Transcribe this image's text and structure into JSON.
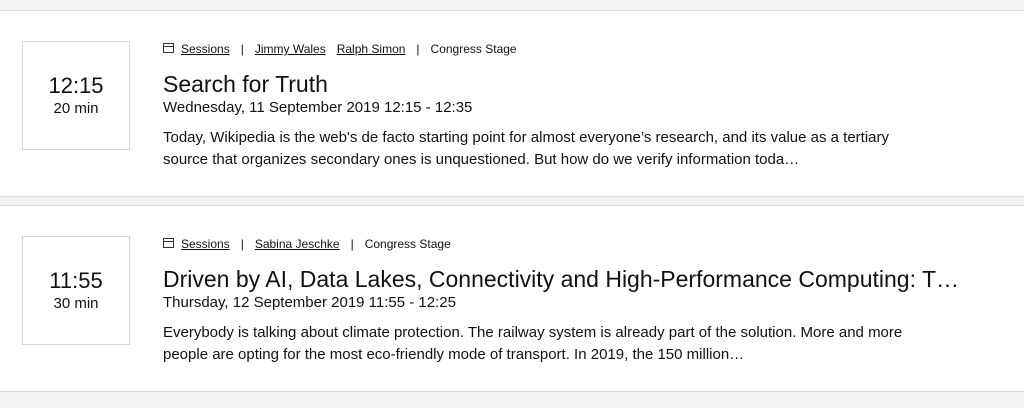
{
  "sessions": [
    {
      "time": "12:15",
      "duration": "20 min",
      "category": "Sessions",
      "speakers": [
        "Jimmy Wales",
        "Ralph Simon"
      ],
      "stage": "Congress Stage",
      "title": "Search for Truth",
      "datetime": "Wednesday, 11 September 2019 12:15 - 12:35",
      "description": "Today, Wikipedia is the web's de facto starting point for almost everyone’s research, and its value as a tertiary source that organizes secondary ones is unquestioned. But how do we verify information toda…"
    },
    {
      "time": "11:55",
      "duration": "30 min",
      "category": "Sessions",
      "speakers": [
        "Sabina Jeschke"
      ],
      "stage": "Congress Stage",
      "title": "Driven by AI, Data Lakes, Connectivity and High-Performance Computing: T…",
      "datetime": "Thursday, 12 September 2019 11:55 - 12:25",
      "description": "Everybody is talking about climate protection. The railway system is already part of the solution. More and more people are opting for the most eco-friendly mode of transport. In 2019, the 150 million…"
    }
  ],
  "separator": "|"
}
